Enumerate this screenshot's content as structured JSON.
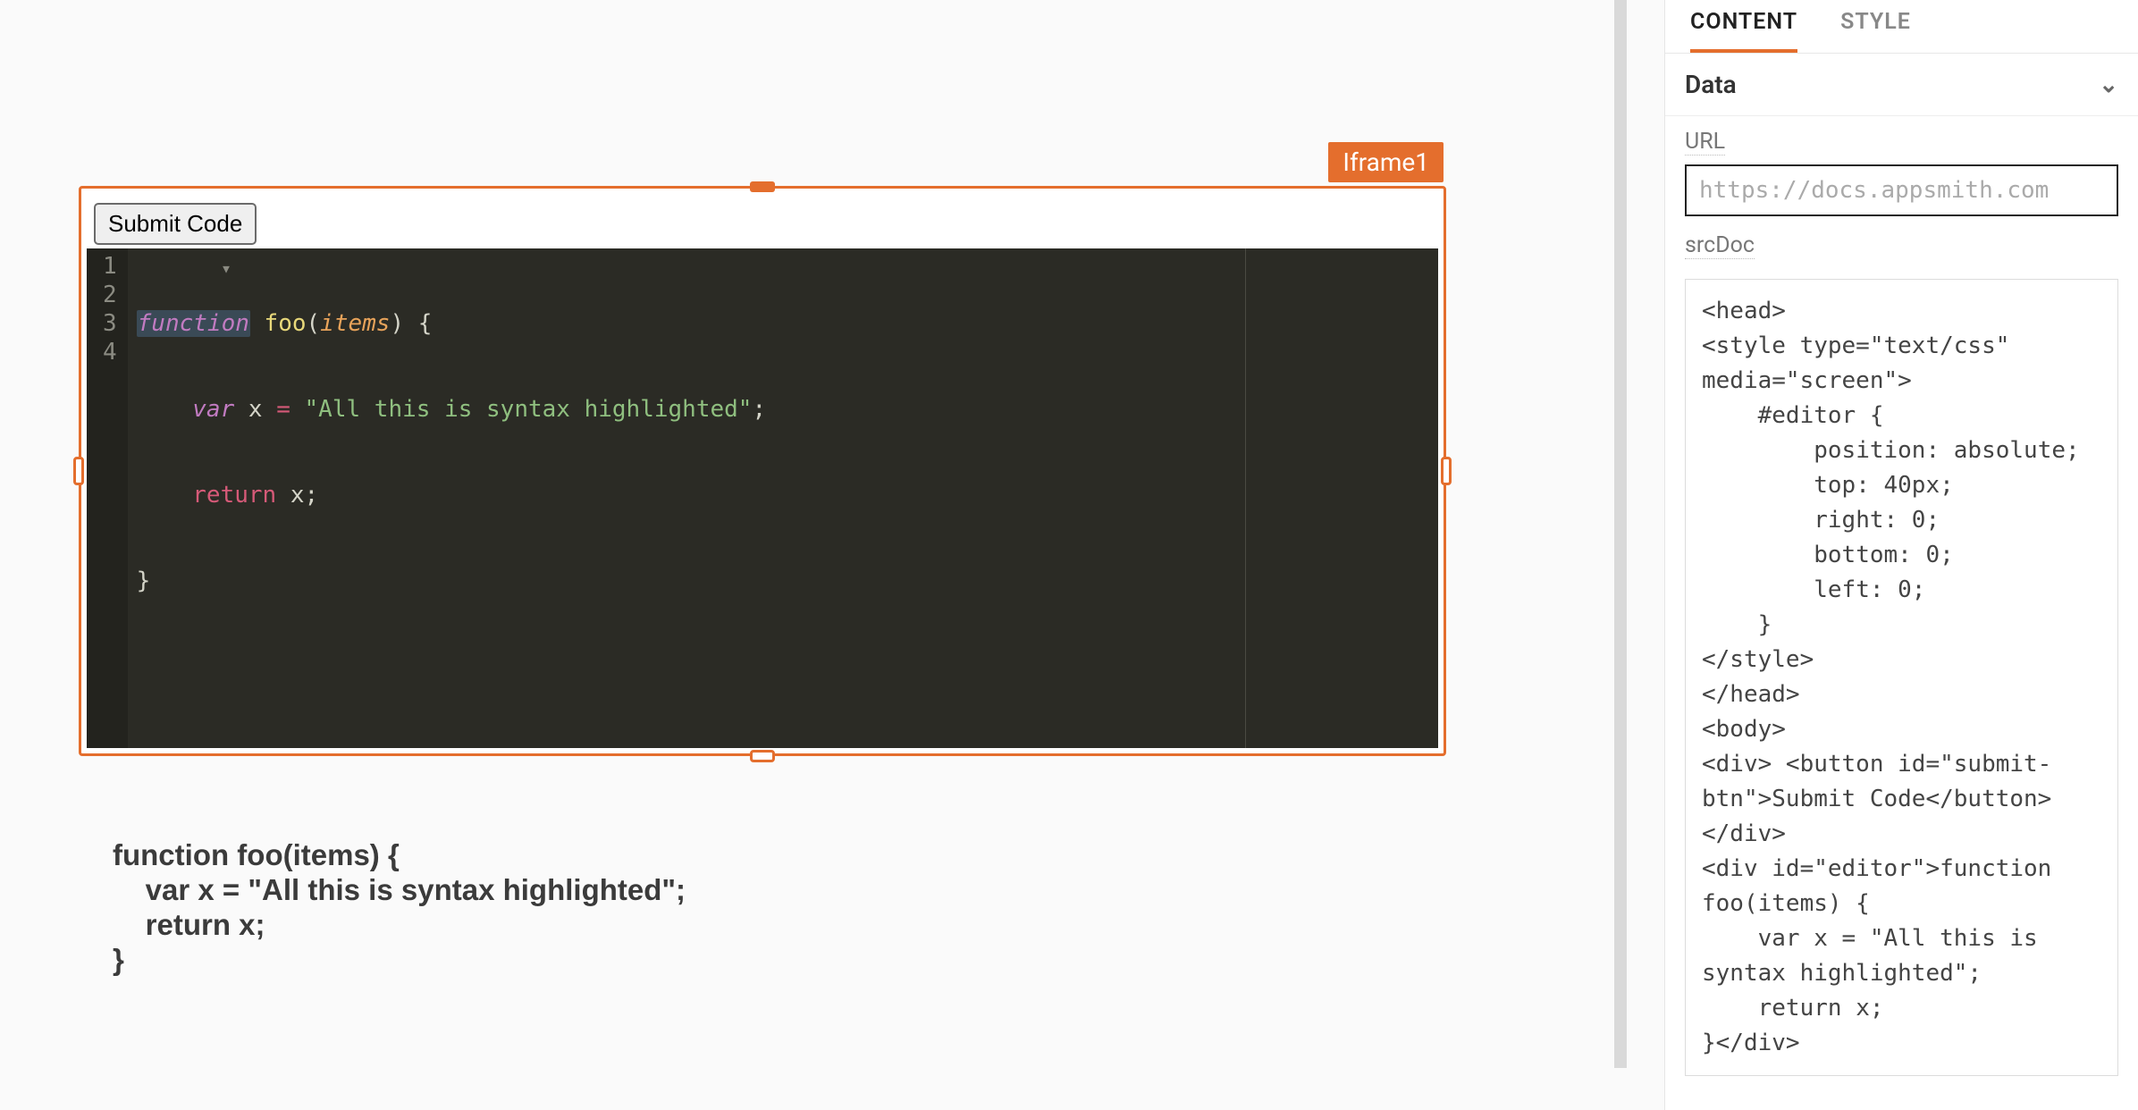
{
  "canvas": {
    "widget_label": "Iframe1",
    "submit_button": "Submit Code",
    "editor": {
      "line_numbers": [
        "1",
        "2",
        "3",
        "4"
      ],
      "tokens": {
        "l1_kw": "function",
        "l1_fn": "foo",
        "l1_paren_open": "(",
        "l1_param": "items",
        "l1_paren_close": ")",
        "l1_brace": " {",
        "l2_indent": "    ",
        "l2_kw": "var",
        "l2_var": " x ",
        "l2_eq": "=",
        "l2_sp": " ",
        "l2_str": "\"All this is syntax highlighted\"",
        "l2_semi": ";",
        "l3_indent": "    ",
        "l3_ret": "return",
        "l3_rest": " x;",
        "l4": "}"
      }
    },
    "output_text": "function foo(items) {\n    var x = \"All this is syntax highlighted\";\n    return x;\n}"
  },
  "panel": {
    "tabs": {
      "content": "CONTENT",
      "style": "STYLE"
    },
    "section_data": "Data",
    "url_label": "URL",
    "url_placeholder": "https://docs.appsmith.com",
    "srcdoc_label": "srcDoc",
    "srcdoc_value": "<head>\n<style type=\"text/css\" media=\"screen\">\n    #editor {\n        position: absolute;\n        top: 40px;\n        right: 0;\n        bottom: 0;\n        left: 0;\n    }\n</style>\n</head>\n<body>\n<div> <button id=\"submit-btn\">Submit Code</button> </div>\n<div id=\"editor\">function foo(items) {\n    var x = \"All this is syntax highlighted\";\n    return x;\n}</div>"
  }
}
